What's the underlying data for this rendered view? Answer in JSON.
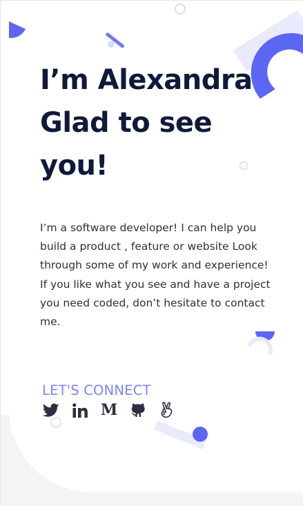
{
  "hero": {
    "headline_line1": "I’m Alexandra",
    "headline_line2": "Glad to see",
    "headline_line3": "you!",
    "bio": "I’m a software developer! I can help you build a product , feature or website Look through some of my work and experience! If you like what you see and have a project you need coded, don’t hesitate to contact me."
  },
  "connect": {
    "label": "LET'S CONNECT",
    "links": [
      {
        "icon": "twitter-icon"
      },
      {
        "icon": "linkedin-icon"
      },
      {
        "icon": "medium-icon",
        "glyph": "M"
      },
      {
        "icon": "github-icon"
      },
      {
        "icon": "angellist-icon"
      }
    ]
  },
  "colors": {
    "accent": "#5b67f3",
    "accent_light": "#7c85f5",
    "decor_pale": "#e9ebfd",
    "heading": "#0f1a3a",
    "body_text": "#2b2f3f"
  }
}
